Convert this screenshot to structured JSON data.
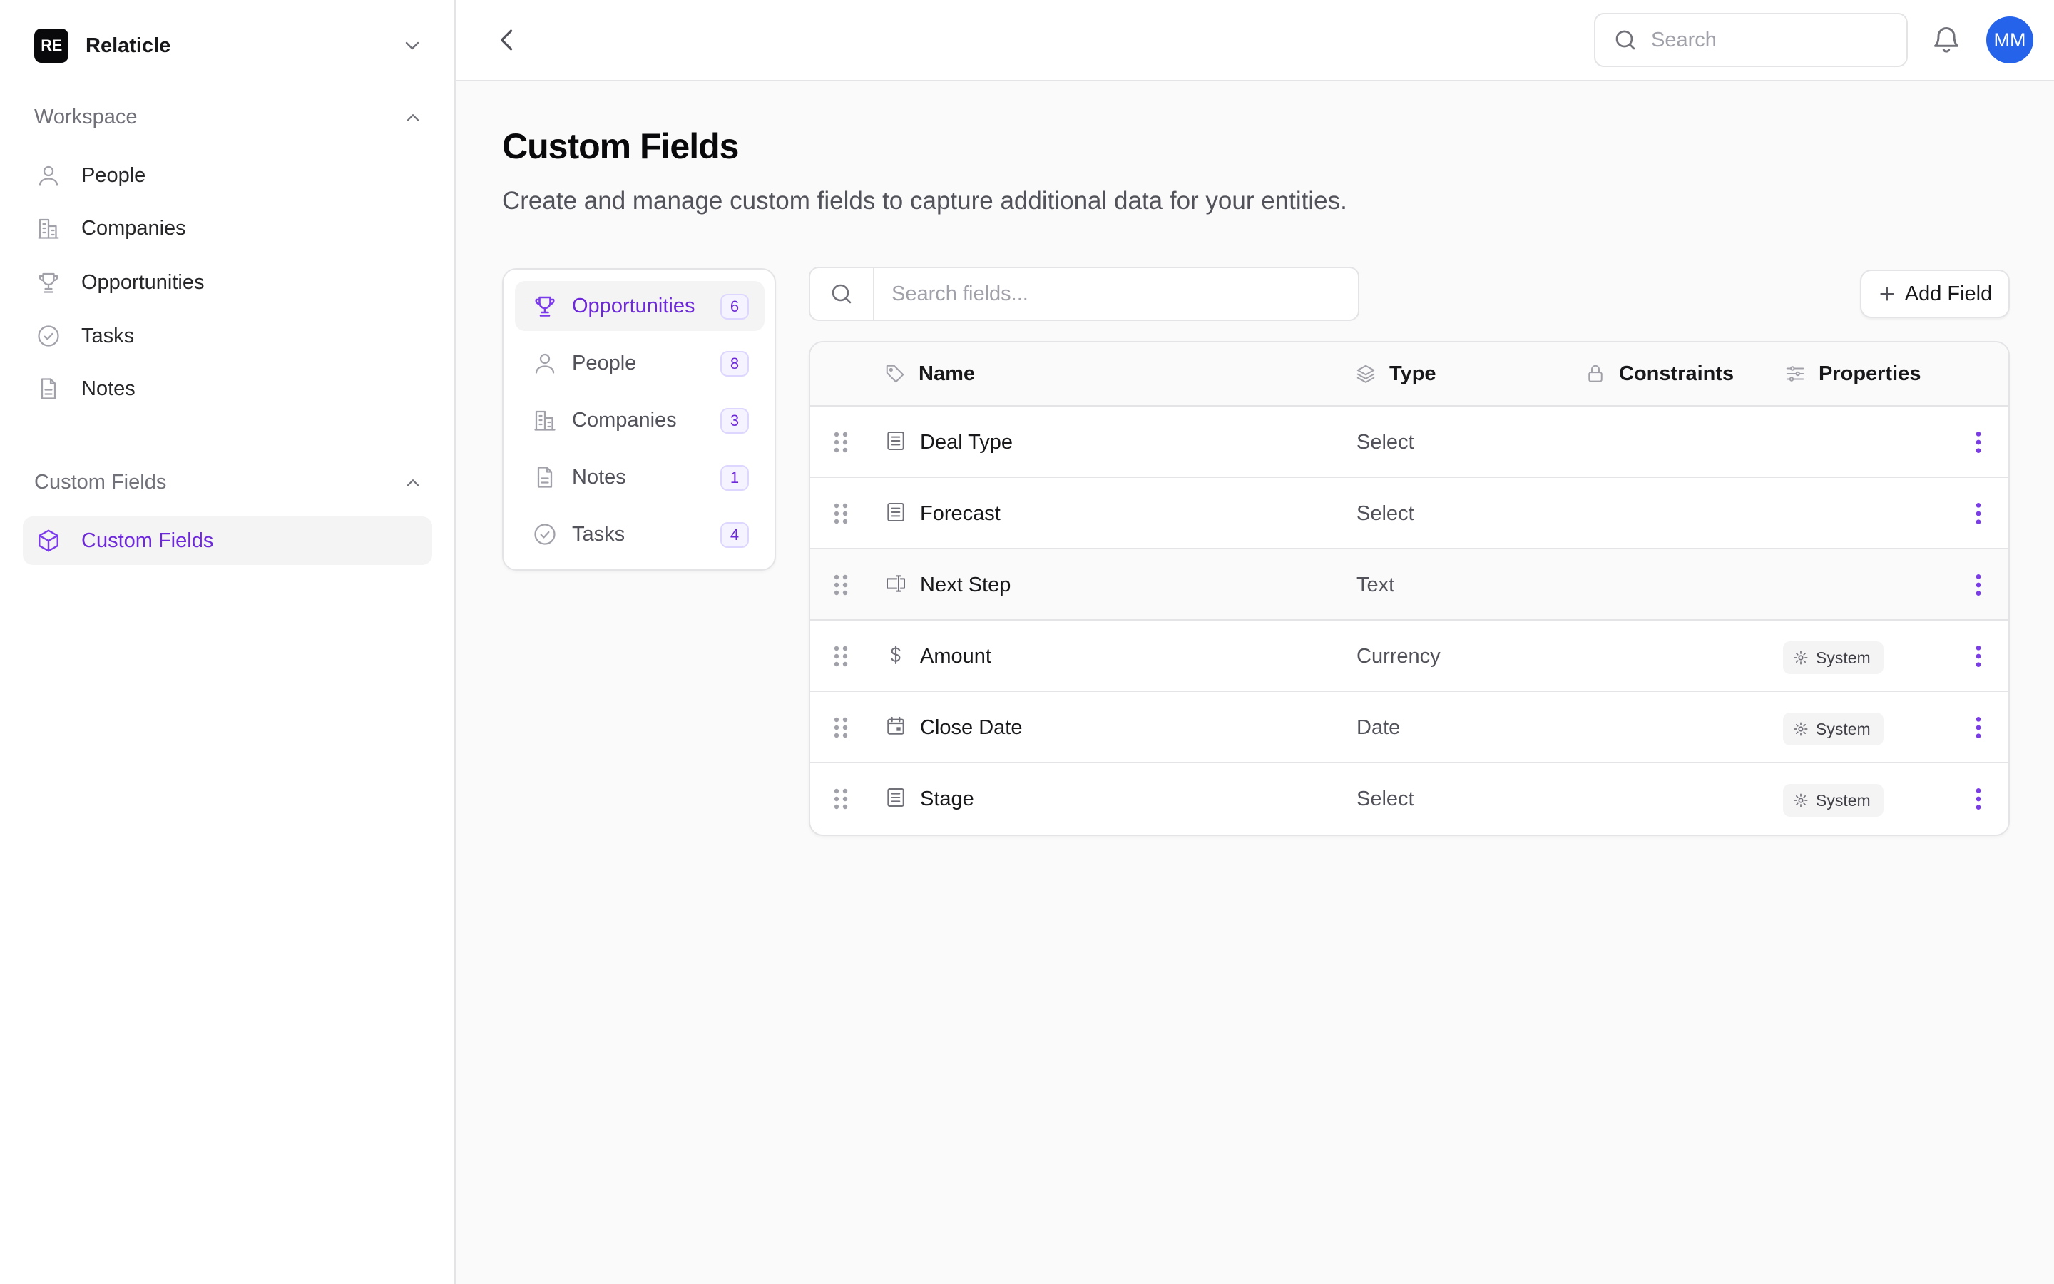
{
  "app": {
    "brand_initials": "RE",
    "brand_name": "Relaticle"
  },
  "sidebar": {
    "workspace_label": "Workspace",
    "workspace_items": [
      {
        "label": "People",
        "icon": "user-icon"
      },
      {
        "label": "Companies",
        "icon": "building-icon"
      },
      {
        "label": "Opportunities",
        "icon": "trophy-icon"
      },
      {
        "label": "Tasks",
        "icon": "check-circle-icon"
      },
      {
        "label": "Notes",
        "icon": "document-icon"
      }
    ],
    "custom_fields_label": "Custom Fields",
    "custom_fields_items": [
      {
        "label": "Custom Fields",
        "icon": "cube-icon",
        "active": true
      }
    ]
  },
  "topbar": {
    "search_placeholder": "Search",
    "avatar_initials": "MM"
  },
  "page": {
    "title": "Custom Fields",
    "description": "Create and manage custom fields to capture additional data for your entities."
  },
  "entities": [
    {
      "label": "Opportunities",
      "count": "6",
      "icon": "trophy-icon",
      "active": true
    },
    {
      "label": "People",
      "count": "8",
      "icon": "user-icon"
    },
    {
      "label": "Companies",
      "count": "3",
      "icon": "building-icon"
    },
    {
      "label": "Notes",
      "count": "1",
      "icon": "document-icon"
    },
    {
      "label": "Tasks",
      "count": "4",
      "icon": "check-circle-icon"
    }
  ],
  "fields_search_placeholder": "Search fields...",
  "add_field_label": "Add Field",
  "table": {
    "headers": {
      "name": "Name",
      "type": "Type",
      "constraints": "Constraints",
      "properties": "Properties"
    },
    "rows": [
      {
        "name": "Deal Type",
        "type": "Select",
        "icon": "list-icon",
        "badge": ""
      },
      {
        "name": "Forecast",
        "type": "Select",
        "icon": "list-icon",
        "badge": ""
      },
      {
        "name": "Next Step",
        "type": "Text",
        "icon": "text-input-icon",
        "badge": ""
      },
      {
        "name": "Amount",
        "type": "Currency",
        "icon": "dollar-icon",
        "badge": "System"
      },
      {
        "name": "Close Date",
        "type": "Date",
        "icon": "calendar-icon",
        "badge": "System"
      },
      {
        "name": "Stage",
        "type": "Select",
        "icon": "list-icon",
        "badge": "System"
      }
    ]
  },
  "colors": {
    "accent": "#7c3aed",
    "avatar": "#2563eb"
  }
}
